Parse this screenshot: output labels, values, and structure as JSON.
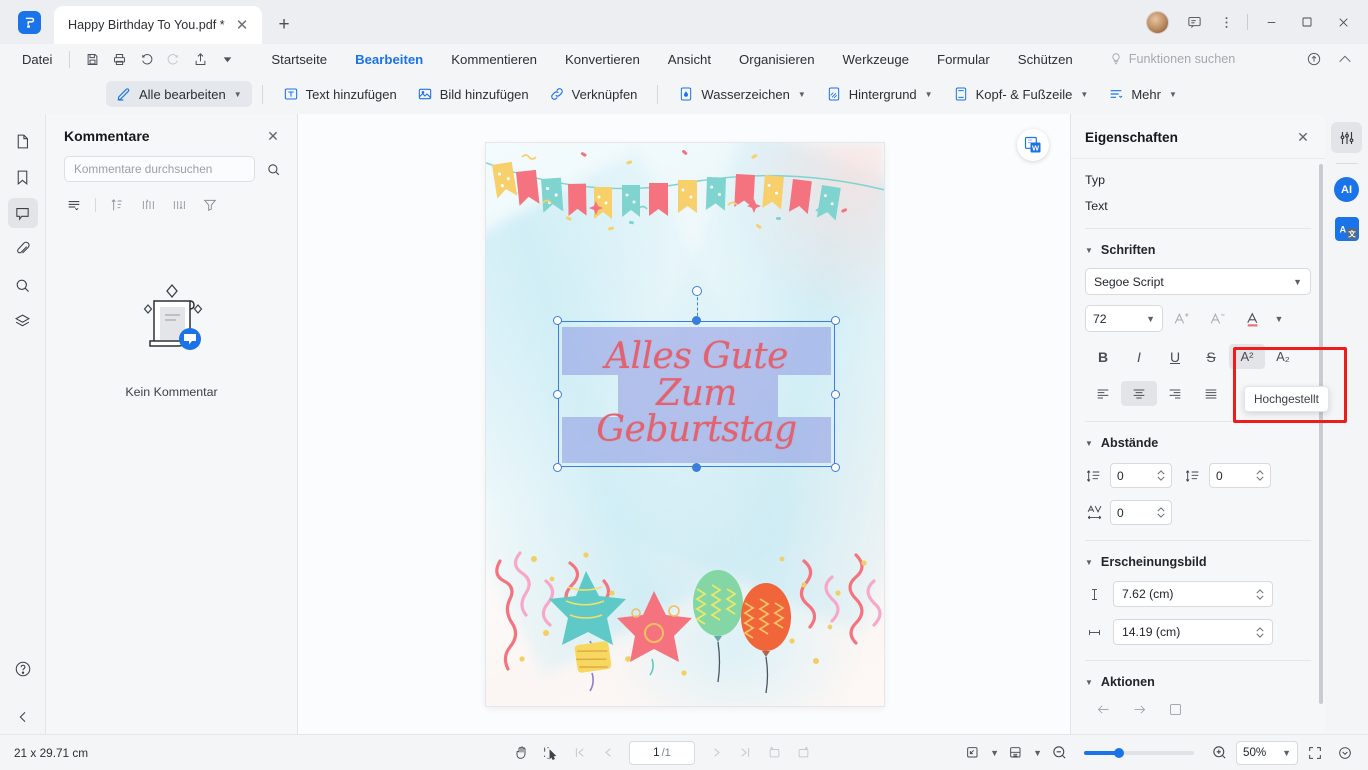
{
  "window": {
    "tab_title": "Happy Birthday To You.pdf *",
    "new_tab_label": "+",
    "close_tab_label": "✕",
    "minimize_label": "—",
    "maximize_label": "□",
    "close_label": "✕",
    "accent_color": "#1a73e8"
  },
  "menu": {
    "file_label": "Datei",
    "items": [
      {
        "label": "Startseite",
        "active": false
      },
      {
        "label": "Bearbeiten",
        "active": true
      },
      {
        "label": "Kommentieren",
        "active": false
      },
      {
        "label": "Konvertieren",
        "active": false
      },
      {
        "label": "Ansicht",
        "active": false
      },
      {
        "label": "Organisieren",
        "active": false
      },
      {
        "label": "Werkzeuge",
        "active": false
      },
      {
        "label": "Formular",
        "active": false
      },
      {
        "label": "Schützen",
        "active": false
      }
    ],
    "find_label": "Funktionen suchen"
  },
  "ribbon": {
    "items": [
      {
        "label": "Alle bearbeiten",
        "caret": true,
        "selected": true
      },
      {
        "label": "Text hinzufügen",
        "caret": false,
        "selected": false
      },
      {
        "label": "Bild hinzufügen",
        "caret": false,
        "selected": false
      },
      {
        "label": "Verknüpfen",
        "caret": false,
        "selected": false
      },
      {
        "label": "Wasserzeichen",
        "caret": true,
        "selected": false
      },
      {
        "label": "Hintergrund",
        "caret": true,
        "selected": false
      },
      {
        "label": "Kopf- & Fußzeile",
        "caret": true,
        "selected": false
      },
      {
        "label": "Mehr",
        "caret": true,
        "selected": false
      }
    ]
  },
  "comments_panel": {
    "title": "Kommentare",
    "close_label": "✕",
    "search_placeholder": "Kommentare durchsuchen",
    "empty_label": "Kein Kommentar"
  },
  "canvas": {
    "document_text_lines": [
      "Alles Gute",
      "Zum",
      "Geburtstag"
    ]
  },
  "properties": {
    "title": "Eigenschaften",
    "close_label": "✕",
    "type_label": "Typ",
    "type_value": "Text",
    "fonts_section": "Schriften",
    "font_family": "Segoe Script",
    "font_size": "72",
    "format_buttons": [
      {
        "name": "bold",
        "label": "B"
      },
      {
        "name": "italic",
        "label": "I"
      },
      {
        "name": "underline",
        "label": "U"
      },
      {
        "name": "strikethrough",
        "label": "S"
      },
      {
        "name": "superscript",
        "label": "A²"
      },
      {
        "name": "subscript",
        "label": "A₂"
      }
    ],
    "tooltip": "Hochgestellt",
    "spacing_section": "Abstände",
    "line_spacing": "0",
    "paragraph_spacing": "0",
    "char_spacing": "0",
    "appearance_section": "Erscheinungsbild",
    "height_value": "7.62 (cm)",
    "width_value": "14.19 (cm)",
    "actions_section": "Aktionen",
    "highlight_color": "#ee1c1c"
  },
  "status_bar": {
    "page_size": "21 x 29.71 cm",
    "current_page": "1",
    "total_pages": "/1",
    "zoom_level": "50%"
  }
}
